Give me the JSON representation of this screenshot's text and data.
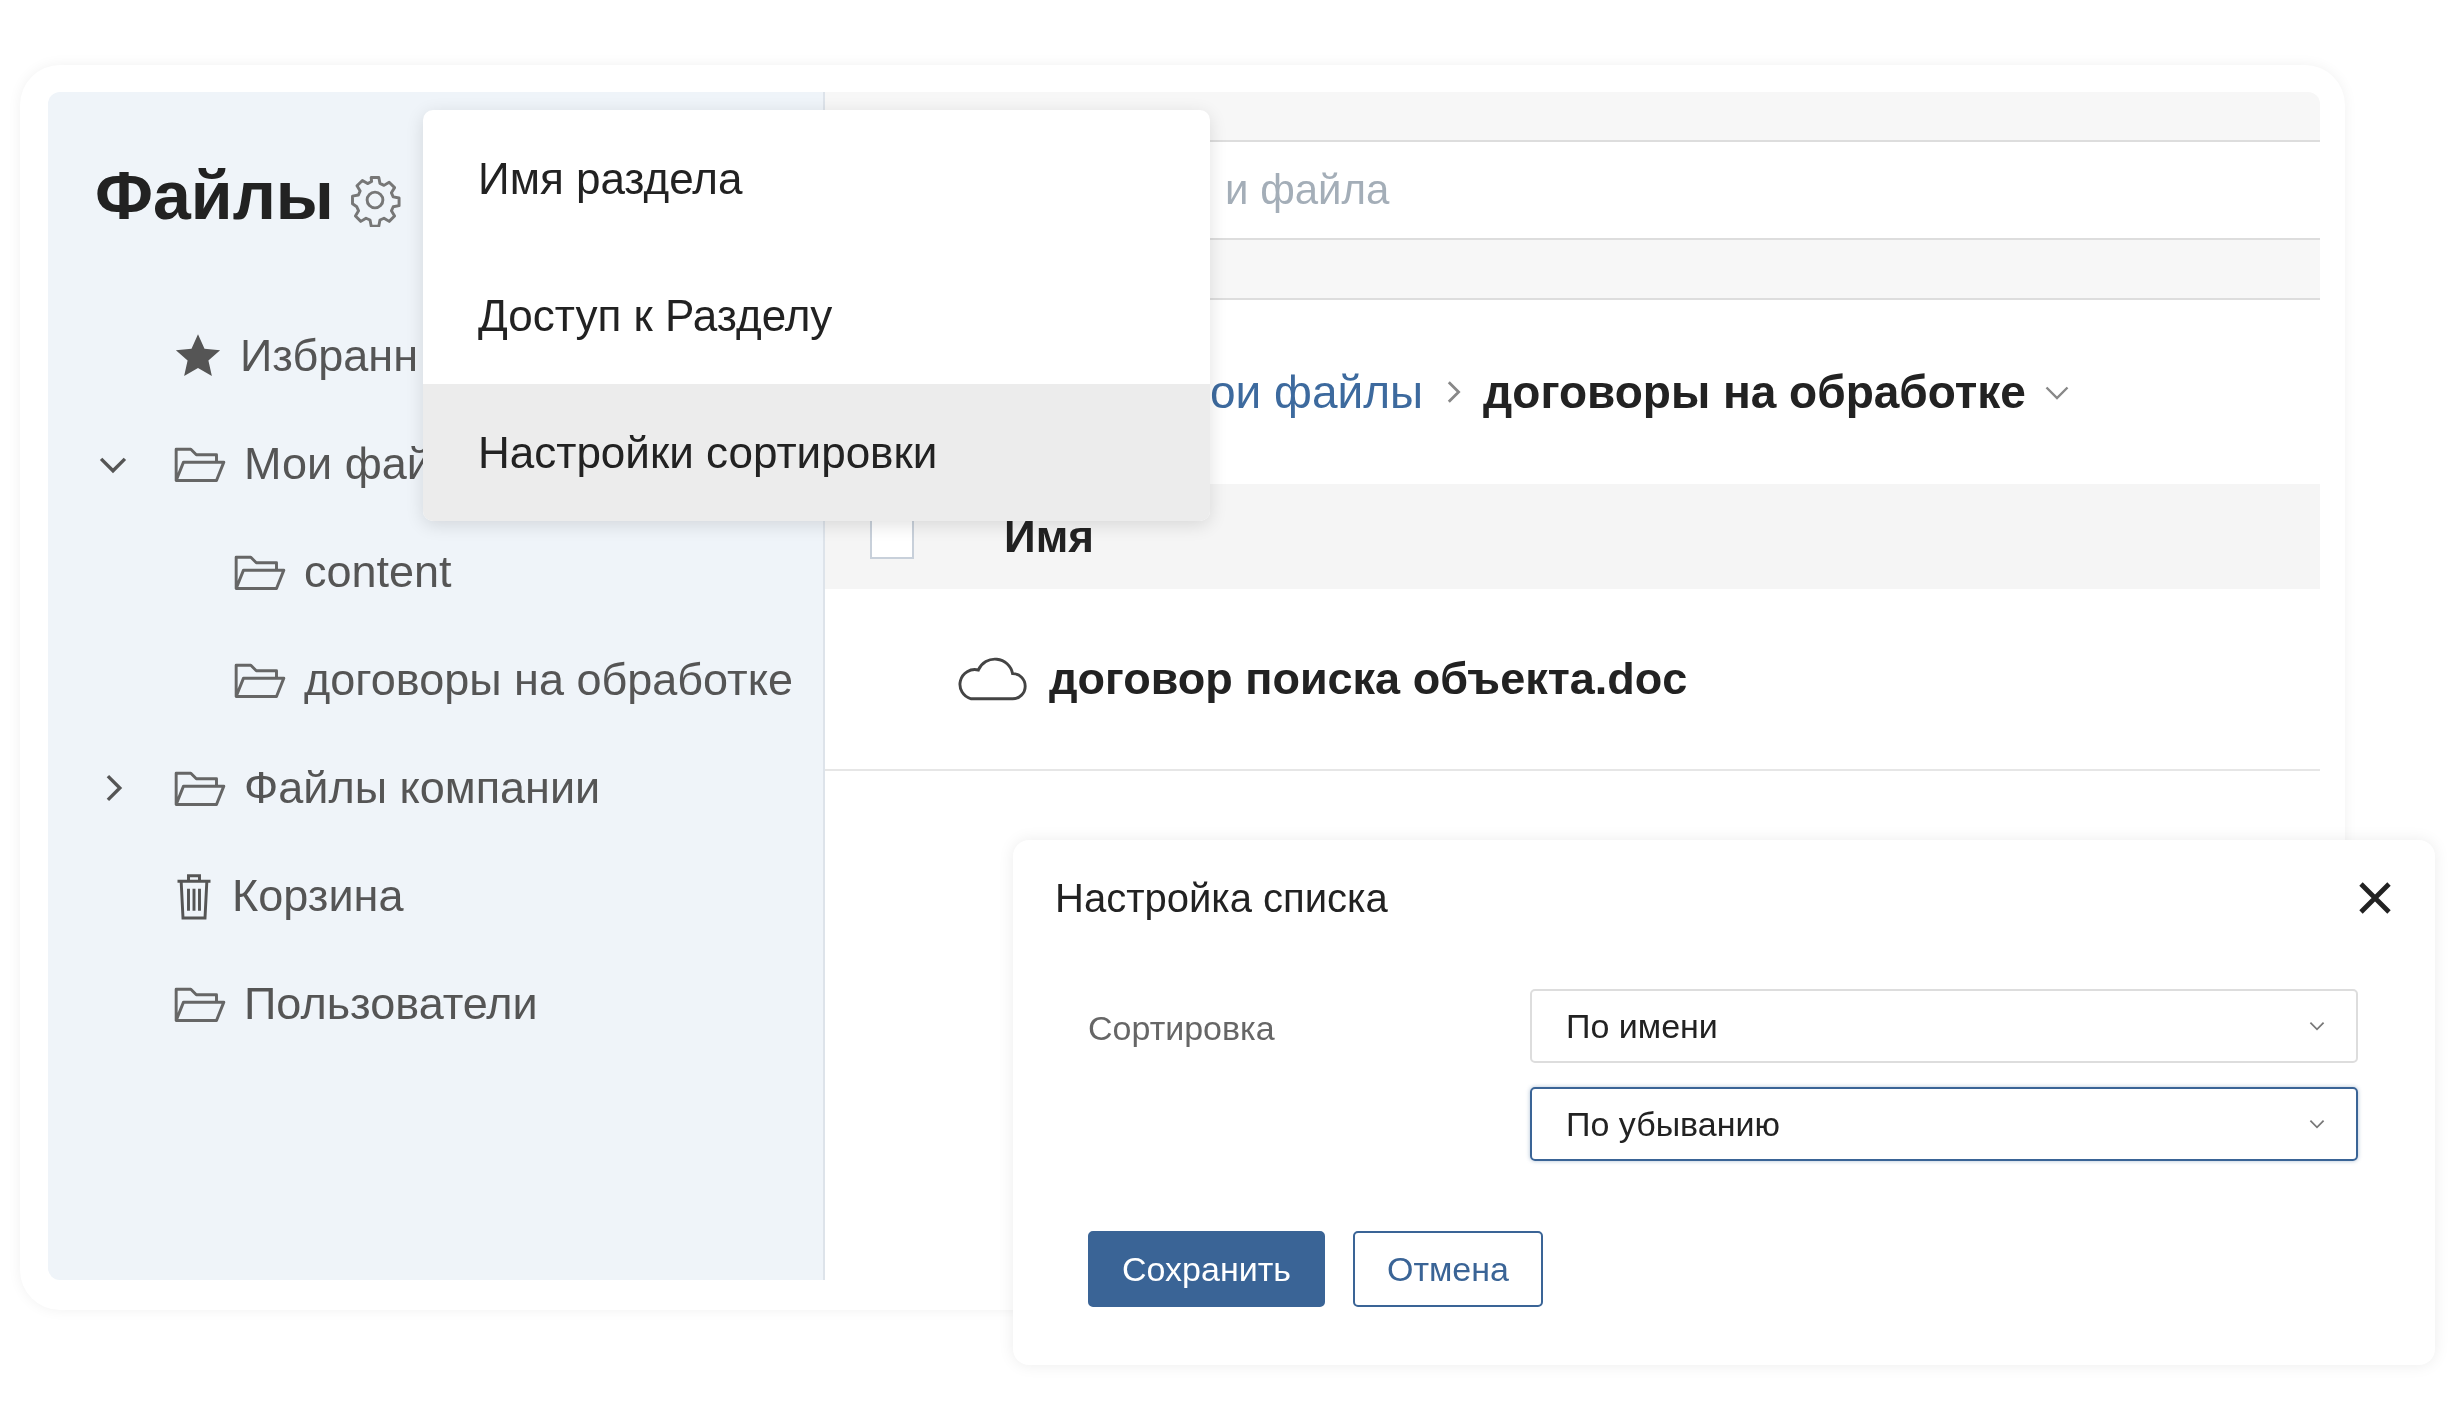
{
  "sidebar": {
    "title": "Файлы",
    "items": [
      {
        "label": "Избранн",
        "kind": "star"
      },
      {
        "label": "Мои фай",
        "kind": "folder",
        "expanded": true,
        "children": [
          {
            "label": "content",
            "kind": "folder"
          },
          {
            "label": "договоры на обработке",
            "kind": "folder"
          }
        ]
      },
      {
        "label": "Файлы компании",
        "kind": "folder",
        "expanded": false
      },
      {
        "label": "Корзина",
        "kind": "trash"
      },
      {
        "label": "Пользователи",
        "kind": "folder"
      }
    ]
  },
  "menu": {
    "items": [
      {
        "label": "Имя раздела",
        "selected": false
      },
      {
        "label": "Доступ к Разделу",
        "selected": false
      },
      {
        "label": "Настройки сортировки",
        "selected": true
      }
    ]
  },
  "search": {
    "placeholder": "и файла"
  },
  "breadcrumb": [
    {
      "label": "ои файлы",
      "current": false
    },
    {
      "label": "договоры на обработке",
      "current": true
    }
  ],
  "table": {
    "header_checkbox": {
      "checked": false
    },
    "columns": [
      "Имя"
    ],
    "rows": [
      {
        "name": "договор поиска объекта.doc",
        "kind": "cloud"
      }
    ]
  },
  "dialog": {
    "title": "Настройка списка",
    "field_label": "Сортировка",
    "selects": [
      {
        "value": "По имени",
        "focused": false
      },
      {
        "value": "По убыванию",
        "focused": true
      }
    ],
    "buttons": [
      {
        "label": "Сохранить",
        "kind": "primary"
      },
      {
        "label": "Отмена",
        "kind": "secondary"
      }
    ]
  }
}
